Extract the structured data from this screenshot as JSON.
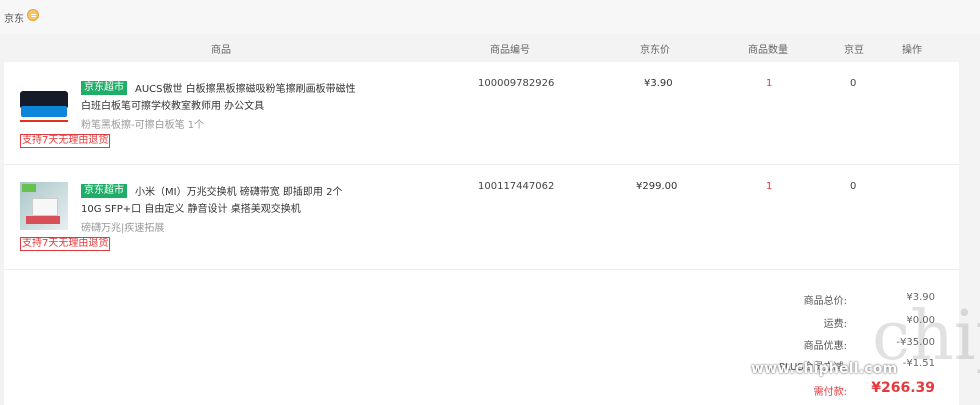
{
  "shop": {
    "name": "京东",
    "chat_icon": "chat-icon"
  },
  "table": {
    "headers": {
      "product": "商品",
      "sku": "商品编号",
      "price": "京东价",
      "quantity": "商品数量",
      "bean": "京豆",
      "action": "操作"
    }
  },
  "items": [
    {
      "badge": "京东超市",
      "title": "AUCS傲世 白板擦黑板擦磁吸粉笔擦刷画板带磁性 白班白板笔可擦学校教室教师用 办公文具",
      "spec": "粉笔黑板擦-可擦白板笔 1个",
      "service": "支持7天无理由退货",
      "sku": "100009782926",
      "price": "¥3.90",
      "quantity": "1",
      "bean": "0"
    },
    {
      "badge": "京东超市",
      "title": "小米（MI）万兆交换机 磅礴带宽 即插即用 2个10G SFP+口 自由定义 静音设计 桌搭美观交换机",
      "spec": "磅礴万兆|疾速拓展",
      "service": "支持7天无理由退货",
      "sku": "100117447062",
      "price": "¥299.00",
      "quantity": "1",
      "bean": "0"
    }
  ],
  "summary": {
    "total_label": "商品总价:",
    "total_value": "¥3​.90",
    "shipping_label": "运费:",
    "shipping_value": "¥0.00",
    "discount_label": "商品优惠:",
    "discount_value": "-¥35.00",
    "plus_label": "PLUS会员立减:",
    "plus_value": "-¥1.51",
    "pay_label": "需付款:",
    "pay_value": "¥266.39"
  },
  "watermark": {
    "text": "chip",
    "url": "www.chiphell.com"
  },
  "colors": {
    "accent": "#e4393c",
    "badge_bg": "#1fae67"
  }
}
